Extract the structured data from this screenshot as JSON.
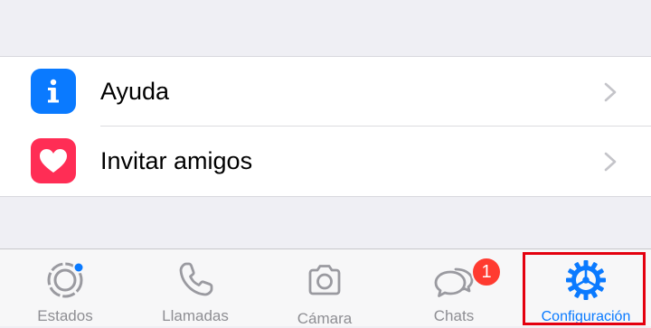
{
  "menu": {
    "items": [
      {
        "label": "Ayuda",
        "icon": "info-icon",
        "color": "#0a7aff"
      },
      {
        "label": "Invitar amigos",
        "icon": "heart-icon",
        "color": "#ff2d55"
      }
    ]
  },
  "tabbar": {
    "tabs": [
      {
        "label": "Estados",
        "icon": "status-icon"
      },
      {
        "label": "Llamadas",
        "icon": "phone-icon"
      },
      {
        "label": "Cámara",
        "icon": "camera-icon"
      },
      {
        "label": "Chats",
        "icon": "chats-icon",
        "badge": "1"
      },
      {
        "label": "Configuración",
        "icon": "settings-gear-icon",
        "selected": true
      }
    ],
    "active_color": "#0a7aff",
    "inactive_color": "#8e8e93",
    "badge_color": "#ff3b30",
    "highlight_color": "#e4000f"
  }
}
